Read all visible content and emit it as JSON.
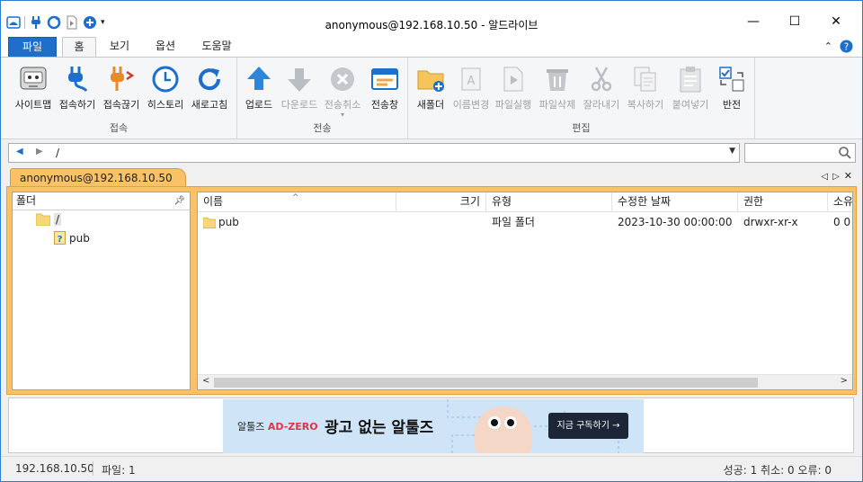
{
  "window": {
    "title": "anonymous@192.168.10.50 - 알드라이브"
  },
  "ribbon_tabs": {
    "file": "파일",
    "home": "홈",
    "view": "보기",
    "options": "옵션",
    "help": "도움말"
  },
  "ribbon": {
    "connect": {
      "label": "접속",
      "site_map": "사이트맵",
      "connect": "접속하기",
      "disconnect": "접속끊기",
      "history": "히스토리",
      "refresh": "새로고침"
    },
    "transfer": {
      "label": "전송",
      "upload": "업로드",
      "download": "다운로드",
      "cancel": "전송취소",
      "window": "전송창"
    },
    "edit": {
      "label": "편집",
      "new_folder": "새폴더",
      "rename": "이름변경",
      "run_file": "파일실행",
      "delete_file": "파일삭제",
      "cut": "잘라내기",
      "copy": "복사하기",
      "paste": "붙여넣기",
      "invert": "반전"
    }
  },
  "address": {
    "path": "/"
  },
  "search": {
    "placeholder": ""
  },
  "session_tab": {
    "label": "anonymous@192.168.10.50"
  },
  "folder_pane": {
    "header": "폴더",
    "tree": [
      {
        "label": "/",
        "icon": "folder-icon",
        "selected": true
      },
      {
        "label": "pub",
        "icon": "unknown-folder-icon",
        "selected": false
      }
    ]
  },
  "file_list": {
    "columns": {
      "name": "이름",
      "size": "크기",
      "type": "유형",
      "modified": "수정한 날짜",
      "perm": "권한",
      "owner": "소유"
    },
    "rows": [
      {
        "name": "pub",
        "size": "",
        "type": "파일 폴더",
        "modified": "2023-10-30 00:00:00",
        "perm": "drwxr-xr-x",
        "owner": "0 0"
      }
    ]
  },
  "ad": {
    "brand": "알툴즈",
    "brand_accent": "AD-ZERO",
    "headline": "광고 없는 알툴즈",
    "cta": "지금 구독하기 →"
  },
  "status": {
    "host": "192.168.10.50",
    "files": "파일: 1",
    "summary": "성공: 1 취소: 0 오류: 0"
  },
  "colors": {
    "accent": "#1e6fc9",
    "session_tab": "#f9c267"
  }
}
